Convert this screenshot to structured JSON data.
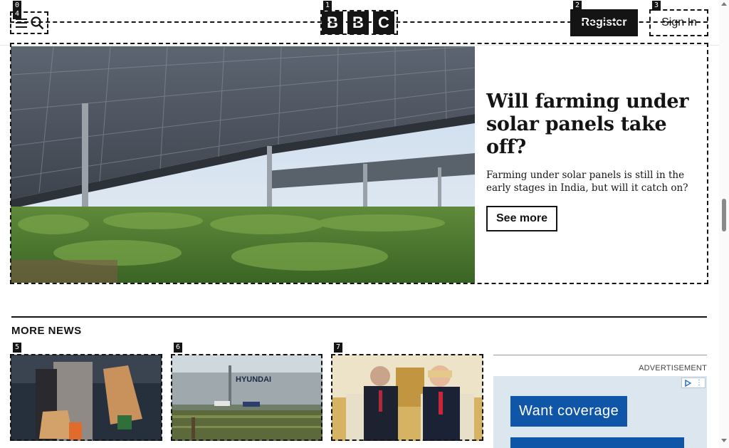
{
  "header": {
    "menu_icon": "hamburger-icon",
    "search_icon": "search-icon",
    "logo_letters": [
      "B",
      "B",
      "C"
    ],
    "register_label": "Register",
    "signin_label": "Sign In"
  },
  "feature": {
    "title": "Will farming under solar panels take off?",
    "summary": "Farming under solar panels is still in the early stages in India, but will it catch on?",
    "cta_label": "See more"
  },
  "more_news": {
    "title": "MORE NEWS"
  },
  "advert": {
    "label": "ADVERTISEMENT",
    "headline": "Want coverage",
    "choices_icon": "ad-choices-icon"
  },
  "annotations": {
    "badges": [
      "0",
      "1",
      "2",
      "3",
      "4",
      "5",
      "6",
      "7"
    ]
  },
  "colors": {
    "ink": "#141414",
    "ad_blue": "#0f55a8"
  }
}
